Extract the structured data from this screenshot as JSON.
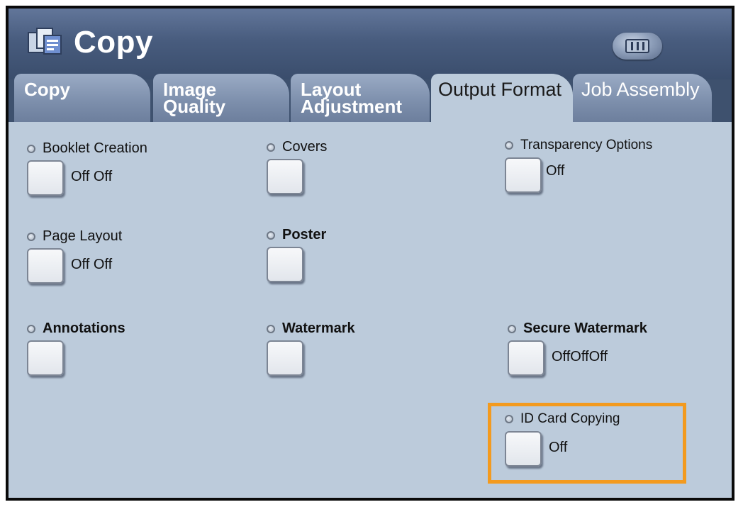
{
  "header": {
    "title": "Copy",
    "app_icon": "copy-app-icon",
    "machine_status_icon": "machine-status-icon"
  },
  "tabs": [
    {
      "label": "Copy",
      "active": false
    },
    {
      "label": "Image Quality",
      "active": false
    },
    {
      "label": "Layout Adjustment",
      "active": false
    },
    {
      "label": "Output Format",
      "active": true
    },
    {
      "label": "Job Assembly",
      "active": false
    }
  ],
  "options": {
    "booklet_creation": {
      "label": "Booklet Creation",
      "value": "Off Off"
    },
    "covers": {
      "label": "Covers",
      "value": ""
    },
    "transparency_options": {
      "label": "Transparency Options",
      "value": "Off"
    },
    "page_layout": {
      "label": "Page Layout",
      "value": "Off Off"
    },
    "poster": {
      "label": "Poster",
      "value": ""
    },
    "annotations": {
      "label": "Annotations",
      "value": ""
    },
    "watermark": {
      "label": "Watermark",
      "value": ""
    },
    "secure_watermark": {
      "label": "Secure Watermark",
      "value": "OffOffOff"
    },
    "id_card_copying": {
      "label": "ID Card Copying",
      "value": "Off"
    }
  },
  "colors": {
    "highlight": "#f39a1e",
    "panel": "#bccbdb",
    "header": "#485c7e"
  }
}
